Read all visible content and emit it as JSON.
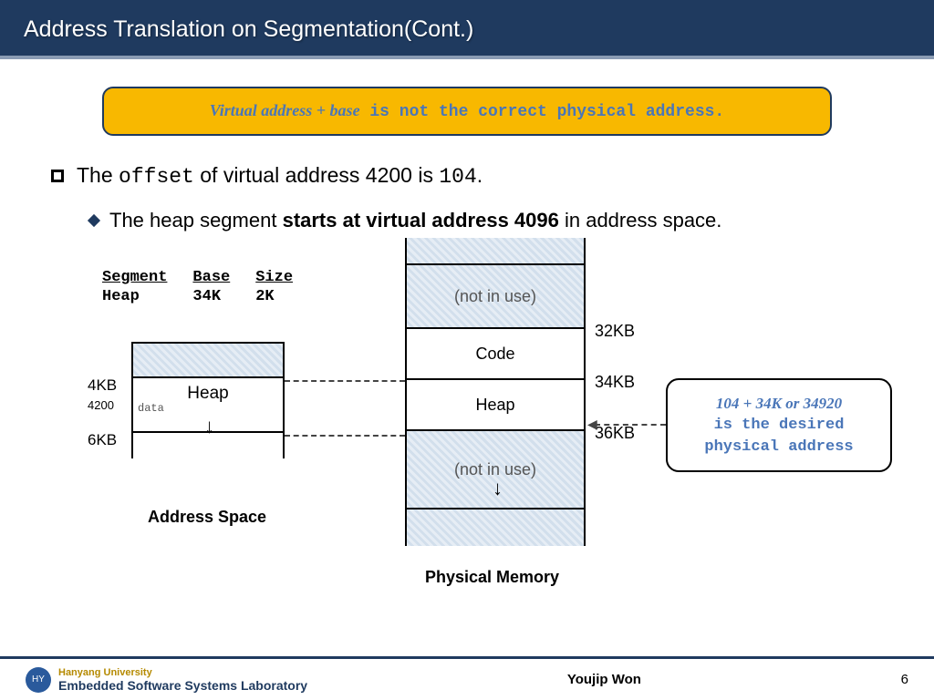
{
  "header": {
    "title": "Address Translation on Segmentation(Cont.)"
  },
  "banner": {
    "math": "Virtual address + base",
    "rest": " is not the correct physical address."
  },
  "bullet": {
    "pre": "The ",
    "code": "offset",
    "mid": " of virtual address 4200 is ",
    "val": "104",
    "post": "."
  },
  "subbullet": {
    "pre": "The heap segment ",
    "strong": "starts at virtual address 4096",
    "post": " in address space."
  },
  "segtable": {
    "h1": "Segment",
    "h2": "Base",
    "h3": "Size",
    "r1c1": "Heap",
    "r1c2": "34K",
    "r1c3": "2K"
  },
  "address_space": {
    "tick1": "4KB",
    "tick2": "4200",
    "tick3": "6KB",
    "heap_label": "Heap",
    "data_label": "data",
    "caption": "Address Space"
  },
  "physical_memory": {
    "notinuse1": "(not in use)",
    "code": "Code",
    "heap": "Heap",
    "notinuse2": "(not in use)",
    "tick1": "32KB",
    "tick2": "34KB",
    "tick3": "36KB",
    "caption": "Physical Memory"
  },
  "callout": {
    "math": "104 + 34K or 34920",
    "line2": "is the desired",
    "line3": "physical address"
  },
  "footer": {
    "univ": "Hanyang University",
    "lab": "Embedded Software Systems Laboratory",
    "author": "Youjip Won",
    "page": "6"
  }
}
